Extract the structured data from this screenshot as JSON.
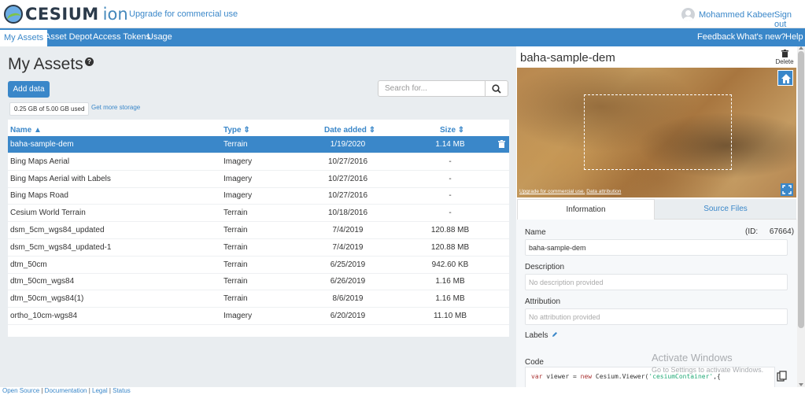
{
  "header": {
    "logo_text": "CESIUM",
    "logo_suffix": "ion",
    "upgrade_link": "Upgrade for commercial use",
    "user_name": "Mohammed Kabeer",
    "signout": "Sign out"
  },
  "nav": {
    "items": [
      "My Assets",
      "Asset Depot",
      "Access Tokens",
      "Usage"
    ],
    "right_items": [
      "Feedback",
      "What's new?",
      "Help"
    ]
  },
  "page": {
    "title": "My Assets",
    "add_button": "Add data",
    "search_placeholder": "Search for...",
    "storage_used": "0.25 GB of 5.00 GB used",
    "storage_link": "Get more storage"
  },
  "table": {
    "columns": [
      "Name",
      "Type",
      "Date added",
      "Size"
    ],
    "rows": [
      {
        "name": "baha-sample-dem",
        "type": "Terrain",
        "date": "1/19/2020",
        "size": "1.14 MB",
        "selected": true
      },
      {
        "name": "Bing Maps Aerial",
        "type": "Imagery",
        "date": "10/27/2016",
        "size": "-"
      },
      {
        "name": "Bing Maps Aerial with Labels",
        "type": "Imagery",
        "date": "10/27/2016",
        "size": "-"
      },
      {
        "name": "Bing Maps Road",
        "type": "Imagery",
        "date": "10/27/2016",
        "size": "-"
      },
      {
        "name": "Cesium World Terrain",
        "type": "Terrain",
        "date": "10/18/2016",
        "size": "-"
      },
      {
        "name": "dsm_5cm_wgs84_updated",
        "type": "Terrain",
        "date": "7/4/2019",
        "size": "120.88 MB"
      },
      {
        "name": "dsm_5cm_wgs84_updated-1",
        "type": "Terrain",
        "date": "7/4/2019",
        "size": "120.88 MB"
      },
      {
        "name": "dtm_50cm",
        "type": "Terrain",
        "date": "6/25/2019",
        "size": "942.60 KB"
      },
      {
        "name": "dtm_50cm_wgs84",
        "type": "Terrain",
        "date": "6/26/2019",
        "size": "1.16 MB"
      },
      {
        "name": "dtm_50cm_wgs84(1)",
        "type": "Terrain",
        "date": "8/6/2019",
        "size": "1.16 MB"
      },
      {
        "name": "ortho_10cm-wgs84",
        "type": "Imagery",
        "date": "6/20/2019",
        "size": "11.10 MB"
      }
    ]
  },
  "detail": {
    "title": "baha-sample-dem",
    "delete_label": "Delete",
    "map_attribution": "Upgrade for commercial use.",
    "map_data_attribution": "Data attribution",
    "tabs": [
      "Information",
      "Source Files"
    ],
    "name_label": "Name",
    "id_label": "(ID:",
    "id_value": "67664)",
    "name_value": "baha-sample-dem",
    "description_label": "Description",
    "description_placeholder": "No description provided",
    "attribution_label": "Attribution",
    "attribution_placeholder": "No attribution provided",
    "labels_label": "Labels",
    "code_label": "Code",
    "code_keyword_var": "var",
    "code_ident": " viewer = ",
    "code_keyword_new": "new",
    "code_class": " Cesium.Viewer(",
    "code_string": "'cesiumContainer'",
    "code_tail": ",{"
  },
  "overlay": {
    "activate_title": "Activate Windows",
    "activate_sub": "Go to Settings to activate Windows."
  },
  "footer": {
    "links": [
      "Open Source",
      "Documentation",
      "Legal",
      "Status"
    ]
  },
  "colors": {
    "accent": "#3a87c9",
    "panel_bg": "#e9edf0"
  }
}
